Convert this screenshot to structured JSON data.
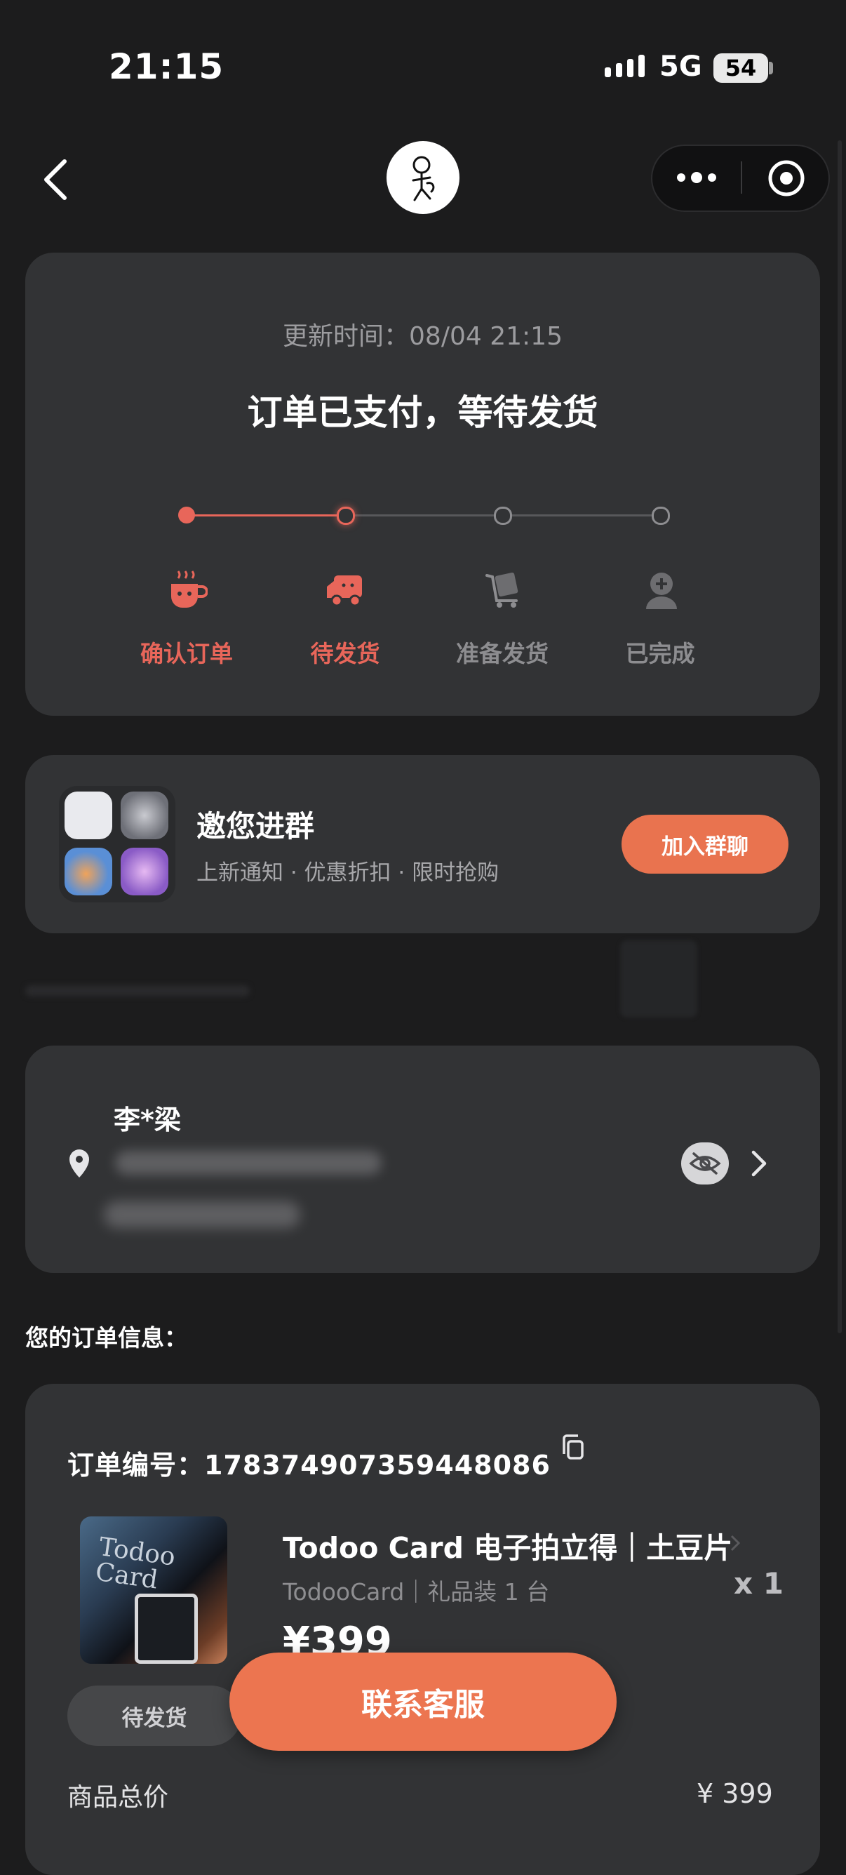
{
  "status_bar": {
    "time": "21:15",
    "network": "5G",
    "battery": "54"
  },
  "nav": {
    "logo_icon": "stick-figure-logo-icon",
    "more_icon": "more-dots-icon",
    "close_icon": "target-circle-icon"
  },
  "order_status": {
    "update_time": "更新时间：08/04 21:15",
    "headline": "订单已支付，等待发货",
    "steps": [
      {
        "label": "确认订单",
        "icon": "coffee-cup-icon",
        "state": "done"
      },
      {
        "label": "待发货",
        "icon": "delivery-truck-icon",
        "state": "current"
      },
      {
        "label": "准备发货",
        "icon": "package-cart-icon",
        "state": "pending"
      },
      {
        "label": "已完成",
        "icon": "person-badge-icon",
        "state": "pending"
      }
    ],
    "colors": {
      "active": "#e8665a",
      "inactive": "#8d8d90",
      "line_inactive": "#58585b"
    }
  },
  "group_invite": {
    "title": "邀您进群",
    "subtitle": "上新通知 · 优惠折扣 · 限时抢购",
    "button": "加入群聊"
  },
  "address": {
    "name": "李*梁"
  },
  "section_title": "您的订单信息：",
  "order": {
    "order_no": "订单编号：178374907359448086",
    "product_name": "Todoo Card 电子拍立得｜土豆片",
    "product_meta": "TodooCard｜礼品装 1 台",
    "thumb_text": "Todoo Card",
    "quantity": "x 1",
    "price": "¥399",
    "status": "待发货",
    "total_label": "商品总价",
    "total_value": "¥ 399"
  },
  "contact_button": "联系客服",
  "accent": "#ec7550"
}
